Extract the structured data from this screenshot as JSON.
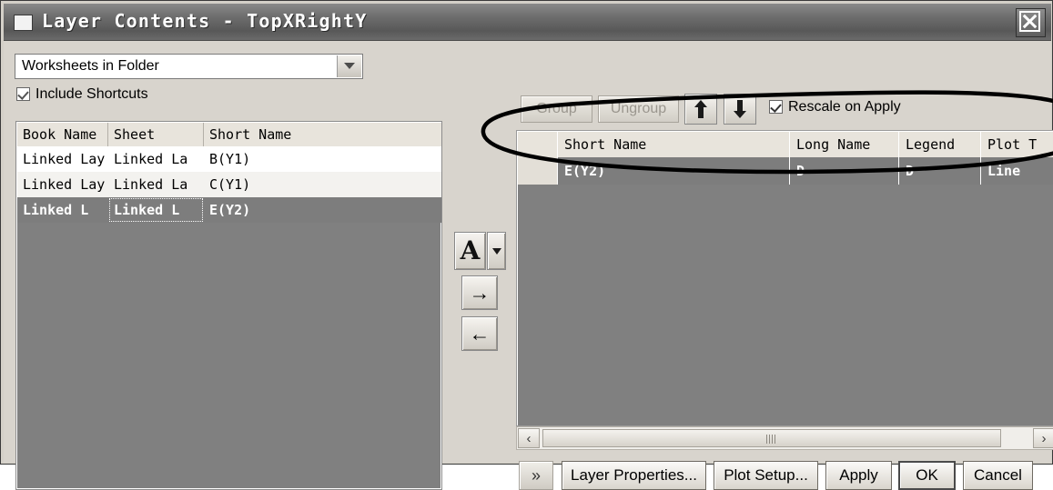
{
  "window": {
    "title": "Layer Contents - TopXRightY",
    "close_label": "X",
    "icon": "window-square-icon"
  },
  "left_pane": {
    "source_combo": {
      "value": "Worksheets in Folder",
      "arrow": "chevron-down-icon"
    },
    "include_shortcuts": {
      "label": "Include Shortcuts",
      "checked": true
    },
    "table": {
      "columns": [
        "Book Name",
        "Sheet",
        "Short Name"
      ],
      "rows": [
        {
          "book": "Linked Lay",
          "sheet": "Linked La",
          "short": "B(Y1)",
          "selected": false
        },
        {
          "book": "Linked Lay",
          "sheet": "Linked La",
          "short": "C(Y1)",
          "selected": false
        },
        {
          "book": "Linked L",
          "sheet": "Linked L",
          "short": "E(Y2)",
          "selected": true
        }
      ]
    }
  },
  "middle_buttons": {
    "font_button": "A",
    "font_dropdown": "chevron-down-icon",
    "add_to_layer": "→",
    "remove_from_layer": "←"
  },
  "right_pane": {
    "toolbar": {
      "group_label": "Group",
      "ungroup_label": "Ungroup",
      "move_up": "arrow-up-icon",
      "move_down": "arrow-down-icon",
      "rescale_on_apply": {
        "label": "Rescale on Apply",
        "checked": true
      }
    },
    "table": {
      "columns": [
        "Short Name",
        "Long Name",
        "Legend",
        "Plot T"
      ],
      "rows": [
        {
          "short_name": "E(Y2)",
          "long_name": "D",
          "legend": "D",
          "plot_type": "Line",
          "selected": true
        }
      ]
    },
    "scrollbar": {
      "left_arrow": "‹",
      "right_arrow": "›"
    }
  },
  "bottom_buttons": {
    "expand": "»",
    "layer_properties": "Layer Properties...",
    "plot_setup": "Plot Setup...",
    "apply": "Apply",
    "ok": "OK",
    "cancel": "Cancel"
  },
  "annotation": {
    "type": "hand-drawn-ellipse",
    "color": "#000000",
    "target": "right-table-selected-row"
  },
  "colors": {
    "titlebar": "#6e6e6e",
    "dialog_face": "#d8d4cd",
    "table_empty": "#808080",
    "selection": "#7d7d7d",
    "header": "#e8e4dc"
  }
}
